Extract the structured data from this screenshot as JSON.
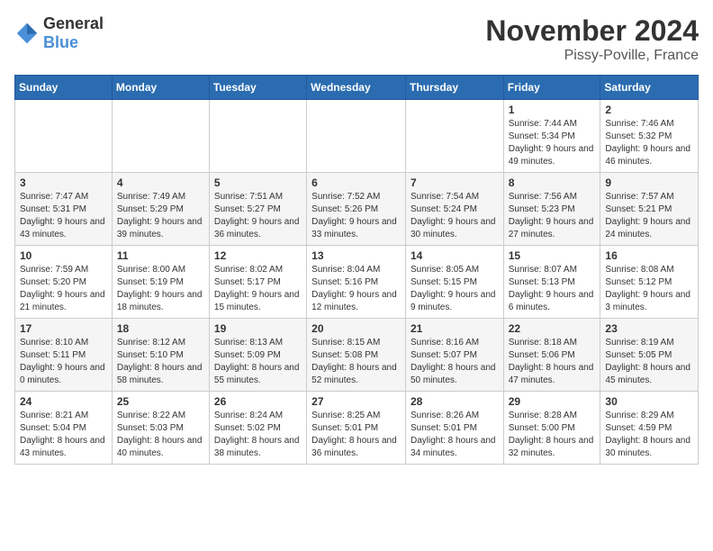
{
  "logo": {
    "text_general": "General",
    "text_blue": "Blue"
  },
  "title": "November 2024",
  "location": "Pissy-Poville, France",
  "weekdays": [
    "Sunday",
    "Monday",
    "Tuesday",
    "Wednesday",
    "Thursday",
    "Friday",
    "Saturday"
  ],
  "weeks": [
    [
      {
        "day": "",
        "sunrise": "",
        "sunset": "",
        "daylight": ""
      },
      {
        "day": "",
        "sunrise": "",
        "sunset": "",
        "daylight": ""
      },
      {
        "day": "",
        "sunrise": "",
        "sunset": "",
        "daylight": ""
      },
      {
        "day": "",
        "sunrise": "",
        "sunset": "",
        "daylight": ""
      },
      {
        "day": "",
        "sunrise": "",
        "sunset": "",
        "daylight": ""
      },
      {
        "day": "1",
        "sunrise": "Sunrise: 7:44 AM",
        "sunset": "Sunset: 5:34 PM",
        "daylight": "Daylight: 9 hours and 49 minutes."
      },
      {
        "day": "2",
        "sunrise": "Sunrise: 7:46 AM",
        "sunset": "Sunset: 5:32 PM",
        "daylight": "Daylight: 9 hours and 46 minutes."
      }
    ],
    [
      {
        "day": "3",
        "sunrise": "Sunrise: 7:47 AM",
        "sunset": "Sunset: 5:31 PM",
        "daylight": "Daylight: 9 hours and 43 minutes."
      },
      {
        "day": "4",
        "sunrise": "Sunrise: 7:49 AM",
        "sunset": "Sunset: 5:29 PM",
        "daylight": "Daylight: 9 hours and 39 minutes."
      },
      {
        "day": "5",
        "sunrise": "Sunrise: 7:51 AM",
        "sunset": "Sunset: 5:27 PM",
        "daylight": "Daylight: 9 hours and 36 minutes."
      },
      {
        "day": "6",
        "sunrise": "Sunrise: 7:52 AM",
        "sunset": "Sunset: 5:26 PM",
        "daylight": "Daylight: 9 hours and 33 minutes."
      },
      {
        "day": "7",
        "sunrise": "Sunrise: 7:54 AM",
        "sunset": "Sunset: 5:24 PM",
        "daylight": "Daylight: 9 hours and 30 minutes."
      },
      {
        "day": "8",
        "sunrise": "Sunrise: 7:56 AM",
        "sunset": "Sunset: 5:23 PM",
        "daylight": "Daylight: 9 hours and 27 minutes."
      },
      {
        "day": "9",
        "sunrise": "Sunrise: 7:57 AM",
        "sunset": "Sunset: 5:21 PM",
        "daylight": "Daylight: 9 hours and 24 minutes."
      }
    ],
    [
      {
        "day": "10",
        "sunrise": "Sunrise: 7:59 AM",
        "sunset": "Sunset: 5:20 PM",
        "daylight": "Daylight: 9 hours and 21 minutes."
      },
      {
        "day": "11",
        "sunrise": "Sunrise: 8:00 AM",
        "sunset": "Sunset: 5:19 PM",
        "daylight": "Daylight: 9 hours and 18 minutes."
      },
      {
        "day": "12",
        "sunrise": "Sunrise: 8:02 AM",
        "sunset": "Sunset: 5:17 PM",
        "daylight": "Daylight: 9 hours and 15 minutes."
      },
      {
        "day": "13",
        "sunrise": "Sunrise: 8:04 AM",
        "sunset": "Sunset: 5:16 PM",
        "daylight": "Daylight: 9 hours and 12 minutes."
      },
      {
        "day": "14",
        "sunrise": "Sunrise: 8:05 AM",
        "sunset": "Sunset: 5:15 PM",
        "daylight": "Daylight: 9 hours and 9 minutes."
      },
      {
        "day": "15",
        "sunrise": "Sunrise: 8:07 AM",
        "sunset": "Sunset: 5:13 PM",
        "daylight": "Daylight: 9 hours and 6 minutes."
      },
      {
        "day": "16",
        "sunrise": "Sunrise: 8:08 AM",
        "sunset": "Sunset: 5:12 PM",
        "daylight": "Daylight: 9 hours and 3 minutes."
      }
    ],
    [
      {
        "day": "17",
        "sunrise": "Sunrise: 8:10 AM",
        "sunset": "Sunset: 5:11 PM",
        "daylight": "Daylight: 9 hours and 0 minutes."
      },
      {
        "day": "18",
        "sunrise": "Sunrise: 8:12 AM",
        "sunset": "Sunset: 5:10 PM",
        "daylight": "Daylight: 8 hours and 58 minutes."
      },
      {
        "day": "19",
        "sunrise": "Sunrise: 8:13 AM",
        "sunset": "Sunset: 5:09 PM",
        "daylight": "Daylight: 8 hours and 55 minutes."
      },
      {
        "day": "20",
        "sunrise": "Sunrise: 8:15 AM",
        "sunset": "Sunset: 5:08 PM",
        "daylight": "Daylight: 8 hours and 52 minutes."
      },
      {
        "day": "21",
        "sunrise": "Sunrise: 8:16 AM",
        "sunset": "Sunset: 5:07 PM",
        "daylight": "Daylight: 8 hours and 50 minutes."
      },
      {
        "day": "22",
        "sunrise": "Sunrise: 8:18 AM",
        "sunset": "Sunset: 5:06 PM",
        "daylight": "Daylight: 8 hours and 47 minutes."
      },
      {
        "day": "23",
        "sunrise": "Sunrise: 8:19 AM",
        "sunset": "Sunset: 5:05 PM",
        "daylight": "Daylight: 8 hours and 45 minutes."
      }
    ],
    [
      {
        "day": "24",
        "sunrise": "Sunrise: 8:21 AM",
        "sunset": "Sunset: 5:04 PM",
        "daylight": "Daylight: 8 hours and 43 minutes."
      },
      {
        "day": "25",
        "sunrise": "Sunrise: 8:22 AM",
        "sunset": "Sunset: 5:03 PM",
        "daylight": "Daylight: 8 hours and 40 minutes."
      },
      {
        "day": "26",
        "sunrise": "Sunrise: 8:24 AM",
        "sunset": "Sunset: 5:02 PM",
        "daylight": "Daylight: 8 hours and 38 minutes."
      },
      {
        "day": "27",
        "sunrise": "Sunrise: 8:25 AM",
        "sunset": "Sunset: 5:01 PM",
        "daylight": "Daylight: 8 hours and 36 minutes."
      },
      {
        "day": "28",
        "sunrise": "Sunrise: 8:26 AM",
        "sunset": "Sunset: 5:01 PM",
        "daylight": "Daylight: 8 hours and 34 minutes."
      },
      {
        "day": "29",
        "sunrise": "Sunrise: 8:28 AM",
        "sunset": "Sunset: 5:00 PM",
        "daylight": "Daylight: 8 hours and 32 minutes."
      },
      {
        "day": "30",
        "sunrise": "Sunrise: 8:29 AM",
        "sunset": "Sunset: 4:59 PM",
        "daylight": "Daylight: 8 hours and 30 minutes."
      }
    ]
  ]
}
